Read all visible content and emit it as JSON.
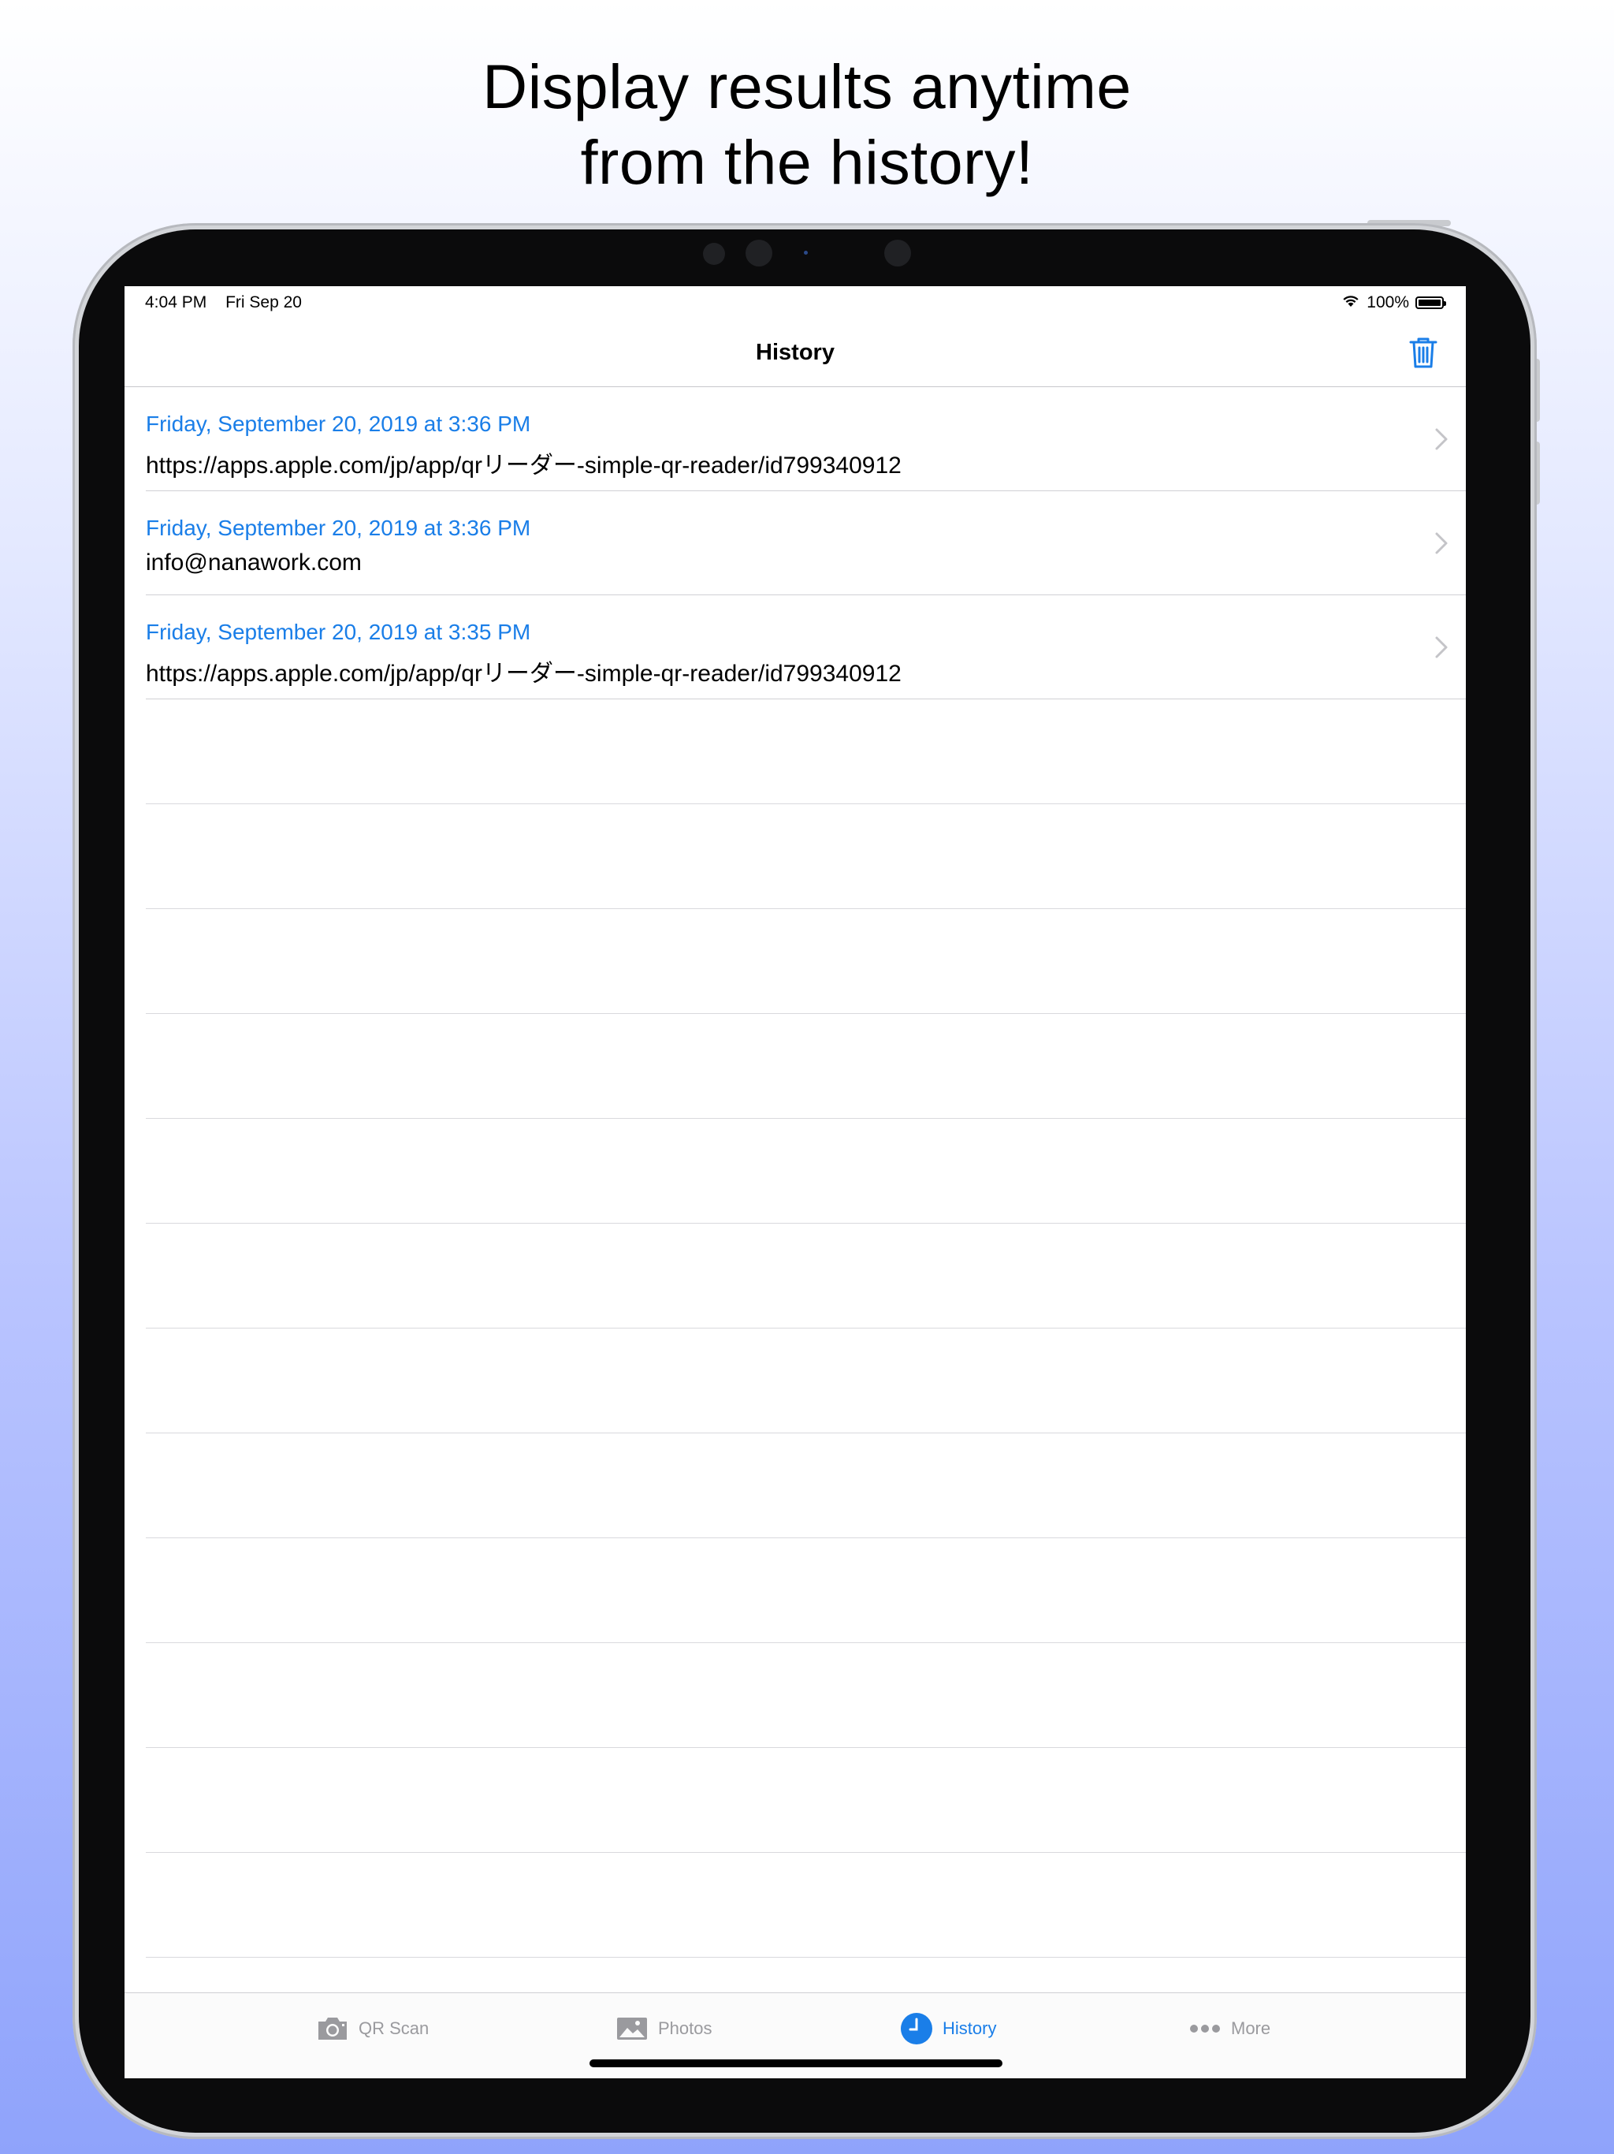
{
  "caption": {
    "line1": "Display results anytime",
    "line2": "from the history!"
  },
  "status_bar": {
    "time": "4:04 PM",
    "date": "Fri Sep 20",
    "battery": "100%",
    "battery_level": 1.0,
    "wifi_icon": "wifi-icon"
  },
  "nav": {
    "title": "History",
    "trash_icon": "trash-icon"
  },
  "history": {
    "items": [
      {
        "date": "Friday, September 20, 2019 at 3:36 PM",
        "value": "https://apps.apple.com/jp/app/qrリーダー-simple-qr-reader/id799340912"
      },
      {
        "date": "Friday, September 20, 2019 at 3:36 PM",
        "value": "info@nanawork.com"
      },
      {
        "date": "Friday, September 20, 2019 at 3:35 PM",
        "value": "https://apps.apple.com/jp/app/qrリーダー-simple-qr-reader/id799340912"
      }
    ]
  },
  "tabs": [
    {
      "label": "QR Scan",
      "icon": "camera-icon",
      "active": false
    },
    {
      "label": "Photos",
      "icon": "photos-icon",
      "active": false
    },
    {
      "label": "History",
      "icon": "clock-icon",
      "active": true
    },
    {
      "label": "More",
      "icon": "more-icon",
      "active": false
    }
  ],
  "colors": {
    "accent": "#1a7ee8",
    "inactive_tab": "#9a9a9e",
    "separator": "#d0d0d4"
  }
}
